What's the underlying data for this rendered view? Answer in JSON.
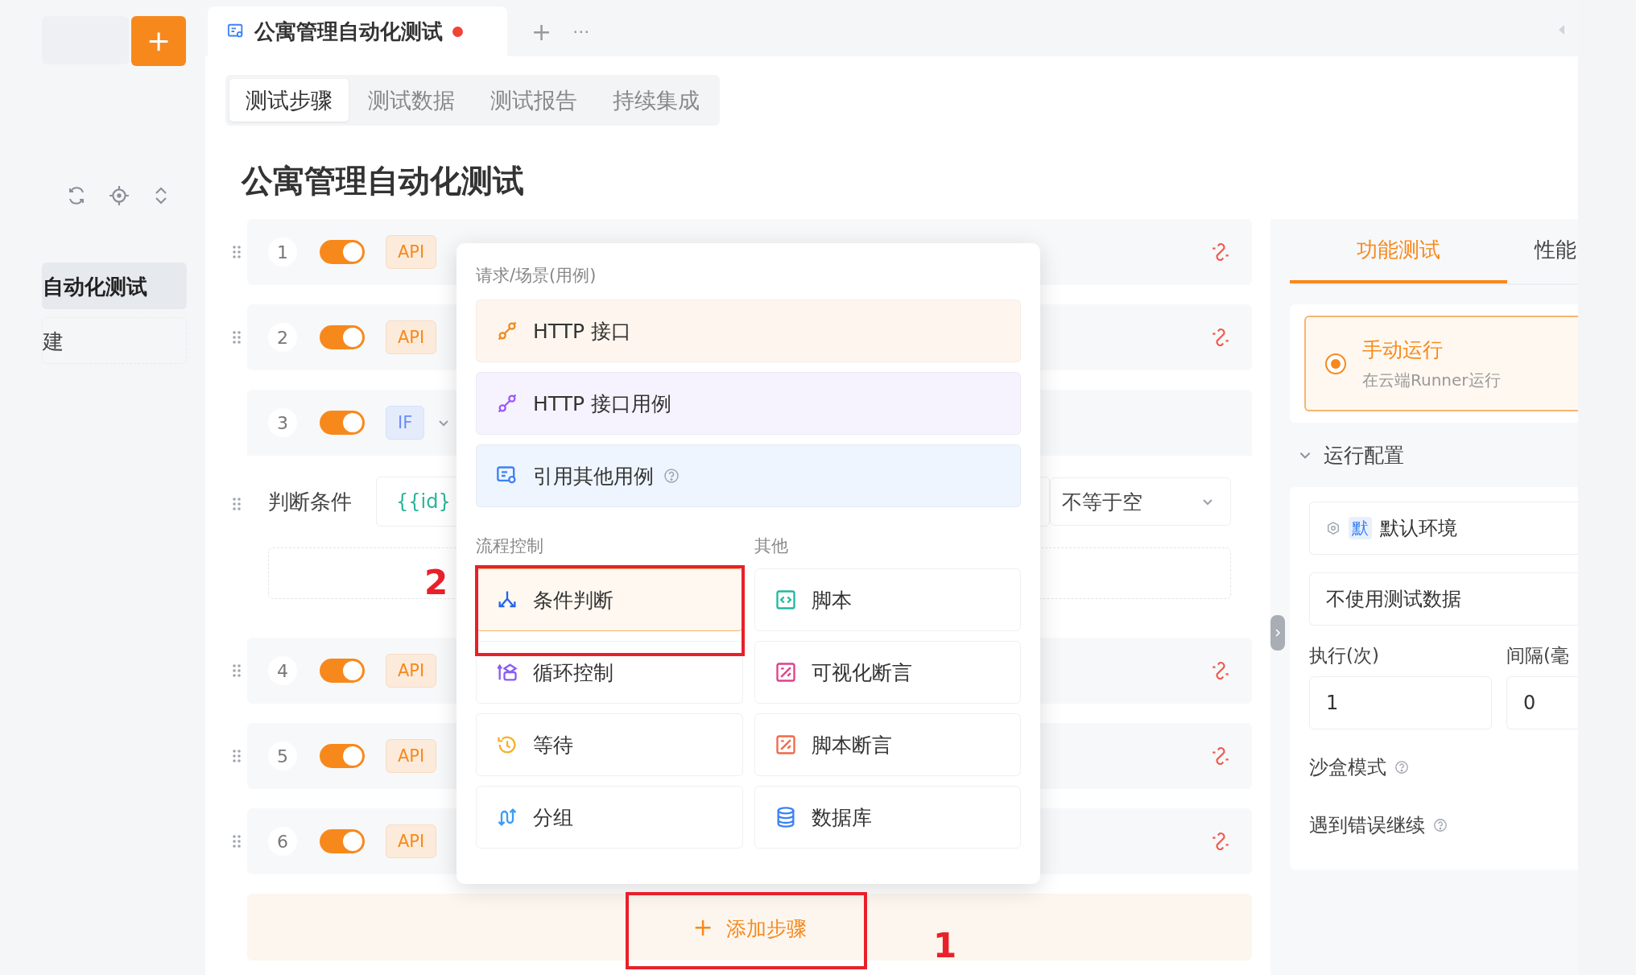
{
  "sidebar": {
    "add_button": "+",
    "items": [
      {
        "label": "自动化测试",
        "selected": true
      },
      {
        "label": "建",
        "selected": false
      }
    ]
  },
  "tab_bar": {
    "tabs": [
      {
        "title": "公寓管理自动化测试",
        "unsaved": true,
        "selected": true
      }
    ],
    "add": "+",
    "more": "···"
  },
  "sub_tabs": [
    {
      "label": "测试步骤",
      "selected": true
    },
    {
      "label": "测试数据",
      "selected": false
    },
    {
      "label": "测试报告",
      "selected": false
    },
    {
      "label": "持续集成",
      "selected": false
    }
  ],
  "heading": "公寓管理自动化测试",
  "steps": [
    {
      "number": "1",
      "enabled": true,
      "tag": "API",
      "kind": "api"
    },
    {
      "number": "2",
      "enabled": true,
      "tag": "API",
      "kind": "api"
    },
    {
      "number": "3",
      "enabled": true,
      "tag": "IF",
      "kind": "if",
      "expanded": true,
      "condition": {
        "label": "判断条件",
        "variable": "{{id}",
        "operator": "不等于空"
      }
    },
    {
      "number": "4",
      "enabled": true,
      "tag": "API",
      "kind": "api"
    },
    {
      "number": "5",
      "enabled": true,
      "tag": "API",
      "kind": "api"
    },
    {
      "number": "6",
      "enabled": true,
      "tag": "API",
      "kind": "api"
    }
  ],
  "add_step": {
    "icon": "+",
    "label": "添加步骤"
  },
  "popup": {
    "groups": [
      {
        "title": "请求/场景(用例)",
        "items": [
          {
            "label": "HTTP 接口",
            "color": "#fef6ee",
            "help": false,
            "selected": false
          },
          {
            "label": "HTTP 接口用例",
            "color": "#f6f3fe",
            "help": false,
            "selected": false
          },
          {
            "label": "引用其他用例",
            "color": "#eef5fe",
            "help": true,
            "selected": false
          }
        ]
      },
      {
        "title": "流程控制",
        "items": [
          {
            "label": "条件判断",
            "selected": true
          },
          {
            "label": "循环控制",
            "selected": false
          },
          {
            "label": "等待",
            "selected": false
          },
          {
            "label": "分组",
            "selected": false
          }
        ]
      },
      {
        "title": "其他",
        "items": [
          {
            "label": "脚本",
            "selected": false
          },
          {
            "label": "可视化断言",
            "selected": false
          },
          {
            "label": "脚本断言",
            "selected": false
          },
          {
            "label": "数据库",
            "selected": false
          }
        ]
      }
    ]
  },
  "annotations": [
    {
      "label": "2"
    },
    {
      "label": "1"
    }
  ],
  "right_panel": {
    "tabs": [
      {
        "label": "功能测试",
        "selected": true
      },
      {
        "label": "性能",
        "selected": false
      }
    ],
    "run_mode": {
      "title": "手动运行",
      "subtitle": "在云端Runner运行",
      "selected": true
    },
    "config": {
      "title": "运行配置",
      "expanded": true,
      "environment": {
        "badge": "默",
        "value": "默认环境"
      },
      "test_data": "不使用测试数据",
      "runs": {
        "label": "执行(次)",
        "value": "1"
      },
      "interval": {
        "label": "间隔(毫",
        "value": "0"
      },
      "options": [
        {
          "label": "沙盒模式"
        },
        {
          "label": "遇到错误继续"
        }
      ]
    }
  }
}
